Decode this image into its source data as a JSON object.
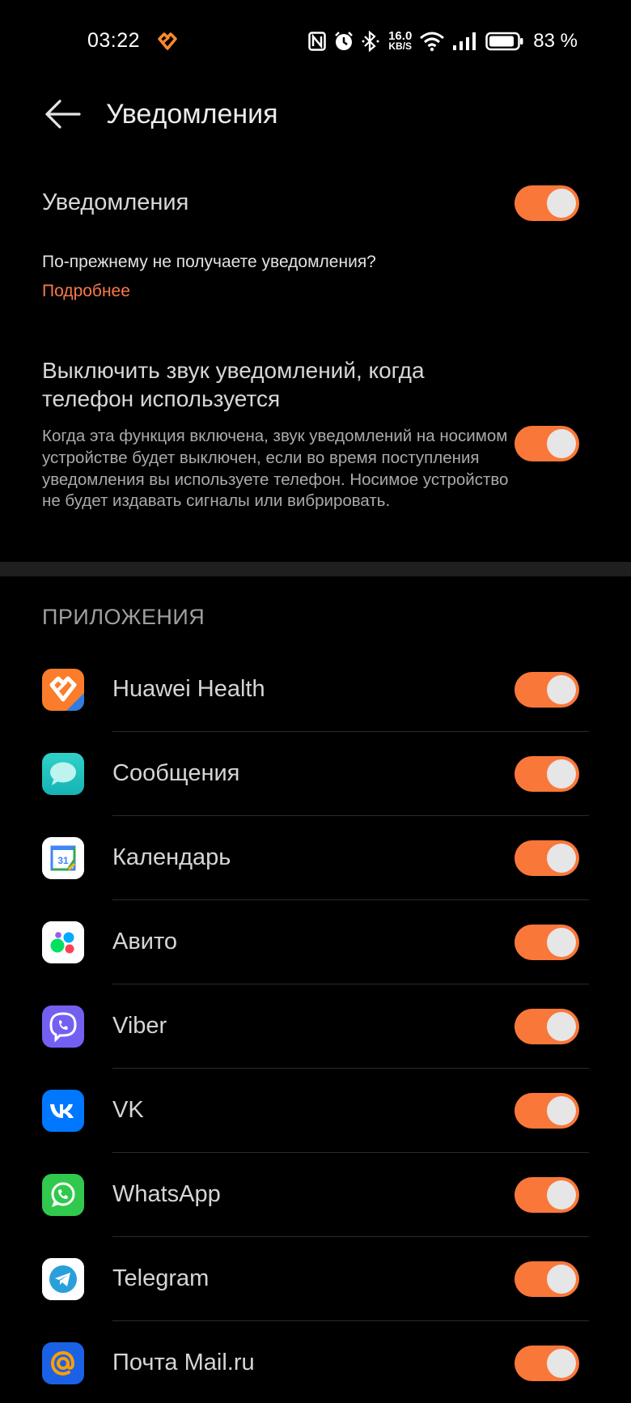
{
  "status_bar": {
    "time": "03:22",
    "speed_value": "16.0",
    "speed_unit": "KB/S",
    "battery_percent": "83 %",
    "icons": [
      "huawei-health-icon",
      "nfc-icon",
      "alarm-icon",
      "bluetooth-icon",
      "wifi-icon",
      "signal-icon",
      "battery-icon"
    ]
  },
  "header": {
    "title": "Уведомления"
  },
  "notifications": {
    "label": "Уведомления",
    "enabled": true,
    "hint": "По-прежнему не получаете уведомления?",
    "more_link": "Подробнее"
  },
  "mute_when_using_phone": {
    "title": "Выключить звук уведомлений, когда телефон используется",
    "description": "Когда эта функция включена, звук уведомлений на носимом устройстве будет выключен, если во время поступления уведомления вы используете телефон. Носимое устройство не будет издавать сигналы или вибрировать.",
    "enabled": true
  },
  "apps_section": {
    "heading": "ПРИЛОЖЕНИЯ",
    "apps": [
      {
        "name": "Huawei Health",
        "icon": "huawei-health-icon",
        "enabled": true
      },
      {
        "name": "Сообщения",
        "icon": "messages-icon",
        "enabled": true
      },
      {
        "name": "Календарь",
        "icon": "calendar-icon",
        "enabled": true,
        "icon_text": "31"
      },
      {
        "name": "Авито",
        "icon": "avito-icon",
        "enabled": true
      },
      {
        "name": "Viber",
        "icon": "viber-icon",
        "enabled": true
      },
      {
        "name": "VK",
        "icon": "vk-icon",
        "enabled": true
      },
      {
        "name": "WhatsApp",
        "icon": "whatsapp-icon",
        "enabled": true
      },
      {
        "name": "Telegram",
        "icon": "telegram-icon",
        "enabled": true
      },
      {
        "name": "Почта Mail.ru",
        "icon": "mail-ru-icon",
        "enabled": true
      }
    ]
  },
  "colors": {
    "accent": "#fa773a",
    "link": "#f9794a",
    "background": "#000000"
  }
}
